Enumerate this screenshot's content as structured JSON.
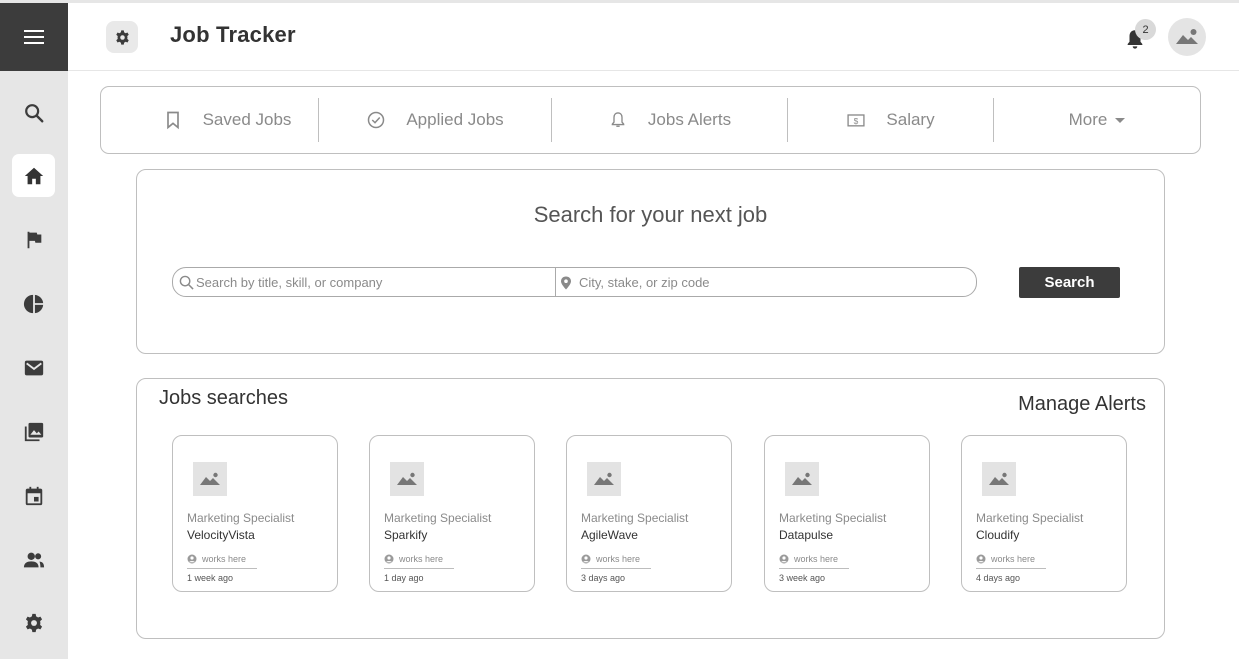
{
  "app": {
    "title": "Job Tracker"
  },
  "header": {
    "notification_count": "2"
  },
  "sidebar": {
    "items": [
      {
        "icon": "search-icon",
        "active": false
      },
      {
        "icon": "home-icon",
        "active": true
      },
      {
        "icon": "flag-icon",
        "active": false
      },
      {
        "icon": "pie-chart-icon",
        "active": false
      },
      {
        "icon": "mail-icon",
        "active": false
      },
      {
        "icon": "gallery-icon",
        "active": false
      },
      {
        "icon": "calendar-icon",
        "active": false
      },
      {
        "icon": "people-icon",
        "active": false
      },
      {
        "icon": "settings-icon",
        "active": false
      }
    ]
  },
  "tabs": [
    {
      "label": "Saved Jobs",
      "icon": "bookmark-icon"
    },
    {
      "label": "Applied Jobs",
      "icon": "check-circle-icon"
    },
    {
      "label": "Jobs Alerts",
      "icon": "bell-icon"
    },
    {
      "label": "Salary",
      "icon": "money-icon"
    },
    {
      "label": "More",
      "icon": "caret-down-icon"
    }
  ],
  "search": {
    "title": "Search for your next job",
    "keyword_placeholder": "Search by title, skill, or company",
    "location_placeholder": "City, stake, or zip code",
    "button_label": "Search"
  },
  "jobs": {
    "title": "Jobs searches",
    "manage_label": "Manage Alerts",
    "cards": [
      {
        "role": "Marketing Specialist",
        "company": "VelocityVista",
        "works": "works here",
        "time": "1 week ago"
      },
      {
        "role": "Marketing Specialist",
        "company": "Sparkify",
        "works": "works here",
        "time": "1 day ago"
      },
      {
        "role": "Marketing Specialist",
        "company": "AgileWave",
        "works": "works here",
        "time": "3 days ago"
      },
      {
        "role": "Marketing Specialist",
        "company": "Datapulse",
        "works": "works here",
        "time": "3 week ago"
      },
      {
        "role": "Marketing Specialist",
        "company": "Cloudify",
        "works": "works here",
        "time": "4 days ago"
      }
    ]
  },
  "colors": {
    "dark": "#3c3c3c",
    "sidebar_bg": "#e6e6e6",
    "border": "#bfbfbf",
    "muted_text": "#8a8a8a"
  }
}
